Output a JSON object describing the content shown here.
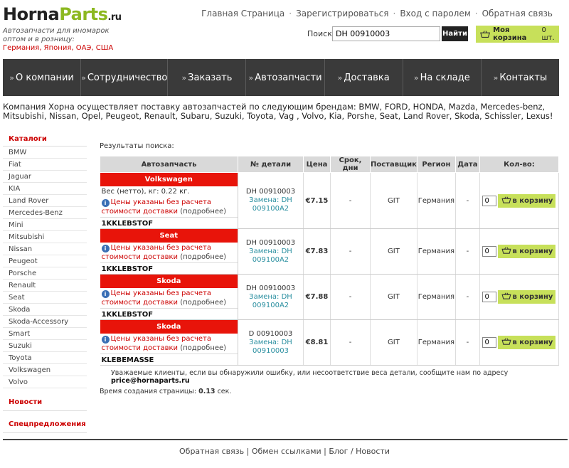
{
  "logo": {
    "part1": "Horna",
    "part2": "Parts",
    "part3": ".ru"
  },
  "tagline": "Автозапчасти для иномарок оптом и в розницу:",
  "tagline_countries": "Германия, Япония, ОАЭ, США",
  "toplinks": [
    "Главная Страница",
    "Зарегистрироваться",
    "Вход с паролем",
    "Обратная связь"
  ],
  "toplinks_sep": "·",
  "search": {
    "label": "Поиск",
    "value": "DH 00910003",
    "button": "Найти"
  },
  "cart": {
    "label": "Моя корзина",
    "count": "0 шт."
  },
  "nav": [
    "О компании",
    "Сотрудничество",
    "Заказать",
    "Автозапчасти",
    "Доставка",
    "На складе",
    "Контакты"
  ],
  "nav_arrow": "»",
  "intro": "Компания Хорна осуществляет поставку автозапчастей по следующим брендам: BMW, FORD, HONDA, Mazda, Mercedes-benz, Mitsubishi, Nissan, Opel, Peugeot, Renault, Subaru, Suzuki, Toyota, Vag , Volvo, Kia, Porshe, Seat, Land Rover, Skoda, Schissler, Lexus!",
  "sidebar": {
    "catalogs_title": "Каталоги",
    "items": [
      "BMW",
      "Fiat",
      "Jaguar",
      "KIA",
      "Land Rover",
      "Mercedes-Benz",
      "Mini",
      "Mitsubishi",
      "Nissan",
      "Peugeot",
      "Porsche",
      "Renault",
      "Seat",
      "Skoda",
      "Skoda-Accessory",
      "Smart",
      "Suzuki",
      "Toyota",
      "Volkswagen",
      "Volvo"
    ],
    "news": "Новости",
    "offers": "Спецпредложения"
  },
  "results_title": "Результаты поиска:",
  "table": {
    "headers": [
      "Автозапчасть",
      "№ детали",
      "Цена",
      "Срок, дни",
      "Поставщик",
      "Регион",
      "Дата",
      "Кол-во:"
    ],
    "note_text": "Цены указаны без расчета стоимости доставки",
    "note_more": "(подробнее)",
    "buy_label": "в корзину",
    "rows": [
      {
        "brand": "Volkswagen",
        "weight": "Вес (нетто), кг: 0.22 кг.",
        "code": "1KKLEBSTOF",
        "number": "DH 00910003",
        "replace": "Замена: DH 009100A2",
        "price": "€7.15",
        "days": "-",
        "supplier": "GIT",
        "region": "Германия",
        "date": "-",
        "qty": "0"
      },
      {
        "brand": "Seat",
        "weight": "",
        "code": "1KKLEBSTOF",
        "number": "DH 00910003",
        "replace": "Замена: DH 009100A2",
        "price": "€7.83",
        "days": "-",
        "supplier": "GIT",
        "region": "Германия",
        "date": "-",
        "qty": "0"
      },
      {
        "brand": "Skoda",
        "weight": "",
        "code": "1KKLEBSTOF",
        "number": "DH 00910003",
        "replace": "Замена: DH 009100A2",
        "price": "€7.88",
        "days": "-",
        "supplier": "GIT",
        "region": "Германия",
        "date": "-",
        "qty": "0"
      },
      {
        "brand": "Skoda",
        "weight": "",
        "code": "KLEBEMASSE",
        "number": "D 00910003",
        "replace": "Замена: DH 00910003",
        "price": "€8.81",
        "days": "-",
        "supplier": "GIT",
        "region": "Германия",
        "date": "-",
        "qty": "0"
      }
    ]
  },
  "notice": {
    "text": "Уважаемые клиенты, если вы обнаружили ошибку, или несоответствие веса детали, сообщите нам по адресу",
    "email": "price@hornaparts.ru"
  },
  "gentime": {
    "label": "Время создания страницы:",
    "value": "0.13",
    "unit": "сек."
  },
  "footer": [
    "Обратная связь",
    "Обмен ссылками",
    "Блог",
    "Новости"
  ],
  "colors": {
    "accent_green": "#c7e05a",
    "brand_red": "#e8140a",
    "nav_bg": "#3a3a3a"
  }
}
